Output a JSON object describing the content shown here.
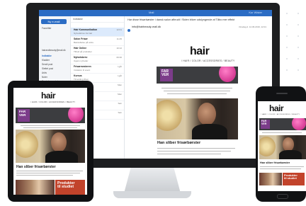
{
  "outlook": {
    "window_title": "Mail",
    "user": "Kor Wister",
    "new_mail": "Ny e-mail",
    "nav": {
      "favorites": "Favoritter",
      "items": [
        "Indbakke",
        "Kladder",
        "Sendt post",
        "Slettet post",
        "Arkiv",
        "Noter",
        "Samtaleoversigt"
      ],
      "account": "hairandbeauty@mail.dk"
    },
    "list_header": "Indbakke",
    "messages": [
      {
        "sender": "Hair Kommunikation",
        "preview": "Nyhedsbrev fra hair",
        "date": "12:01"
      },
      {
        "sender": "Salon Frisør",
        "preview": "Bekræftelse på ordre",
        "date": "11:45"
      },
      {
        "sender": "Hair Online",
        "preview": "Tilbud på produkter",
        "date": "10:12"
      },
      {
        "sender": "Nyhedsbrev",
        "preview": "Ugens nyheder",
        "date": "09:30"
      },
      {
        "sender": "Frisørmesteren",
        "preview": "Invitation til event",
        "date": "I går"
      },
      {
        "sender": "Kursus",
        "preview": "Tilmelding åben",
        "date": "I går"
      },
      {
        "sender": "Leverandør",
        "preview": "Faktura vedhæftet",
        "date": "Man"
      },
      {
        "sender": "Hair Magazine",
        "preview": "Nyt nummer ude",
        "date": "Man"
      },
      {
        "sender": "Salon Frisør",
        "preview": "Påmindelse",
        "date": "Søn"
      },
      {
        "sender": "Kollega",
        "preview": "Vagtplan",
        "date": "Søn"
      }
    ],
    "reading": {
      "subject": "Har disse frisørbørster i dansk salon afbrudt / Siden bliver udslyngende af Tåbo mer effekt",
      "from": "info@hairbeauty-mail.dk",
      "date": "Onsdag d. 12.06.2019, 12:01"
    }
  },
  "newsletter": {
    "logo": "hair",
    "tagline": "/ HAIR / COLOR / ACCESSORIES / BEAUTY",
    "banner_lines": [
      "FAR",
      "VER"
    ],
    "headline": "Han sliber frisørbørster",
    "products_lines": [
      "Produkter",
      "til studiet"
    ]
  },
  "colors": {
    "outlook_blue": "#2b6cc4",
    "banner_bg": "#3c3d40",
    "banner_purple": "#7c3c8a",
    "product_red": "#c2432b"
  }
}
